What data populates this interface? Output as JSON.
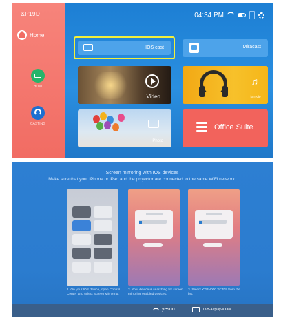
{
  "top": {
    "brand": "T&P19D",
    "home_label": "Home",
    "hdmi_label": "HDMI",
    "cast_side_label": "CASTING",
    "time": "04:34 PM",
    "tiles": {
      "ios_cast": "IOS cast",
      "miracast": "Miracast",
      "video": "Video",
      "music": "Music",
      "photo": "Photo",
      "office": "Office Suite"
    },
    "colors": {
      "selected_outline": "#f2ef3b",
      "sidebar": "#f16c63",
      "background": "#2a8fe0"
    }
  },
  "bottom": {
    "title": "Screen mirroring with IOS devices",
    "subtitle": "Make sure that your iPhone or iPad and the projector are connected to the same WiFi network.",
    "steps": [
      "1. On your IOS device, open Control Center and select Screen Mirroring.",
      "2. Your device is searching for screen mirroring enabled devices.",
      "3. Select YYPN000 YC709 from the list."
    ],
    "footer": {
      "ssid": "yesuo",
      "device": "TKB-Airplay-XXXX"
    }
  }
}
